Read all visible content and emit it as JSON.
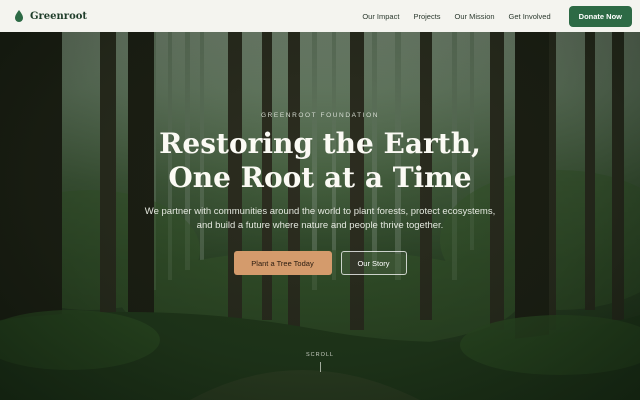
{
  "nav": {
    "brand": "Greenroot",
    "links": [
      "Our Impact",
      "Projects",
      "Our Mission",
      "Get Involved"
    ],
    "donate_label": "Donate Now"
  },
  "hero": {
    "eyebrow": "GREENROOT FOUNDATION",
    "headline_line1": "Restoring the Earth,",
    "headline_line2": "One Root at a Time",
    "subtext": "We partner with communities around the world to plant forests, protect ecosystems, and build a future where nature and people thrive together.",
    "primary_cta": "Plant a Tree Today",
    "secondary_cta": "Our Story",
    "scroll_label": "SCROLL"
  },
  "colors": {
    "brand_green": "#2d6a45",
    "cta_tan": "#d49b6c",
    "nav_bg": "#f4f4ef"
  },
  "icons": {
    "logo": "leaf-drop-icon"
  }
}
